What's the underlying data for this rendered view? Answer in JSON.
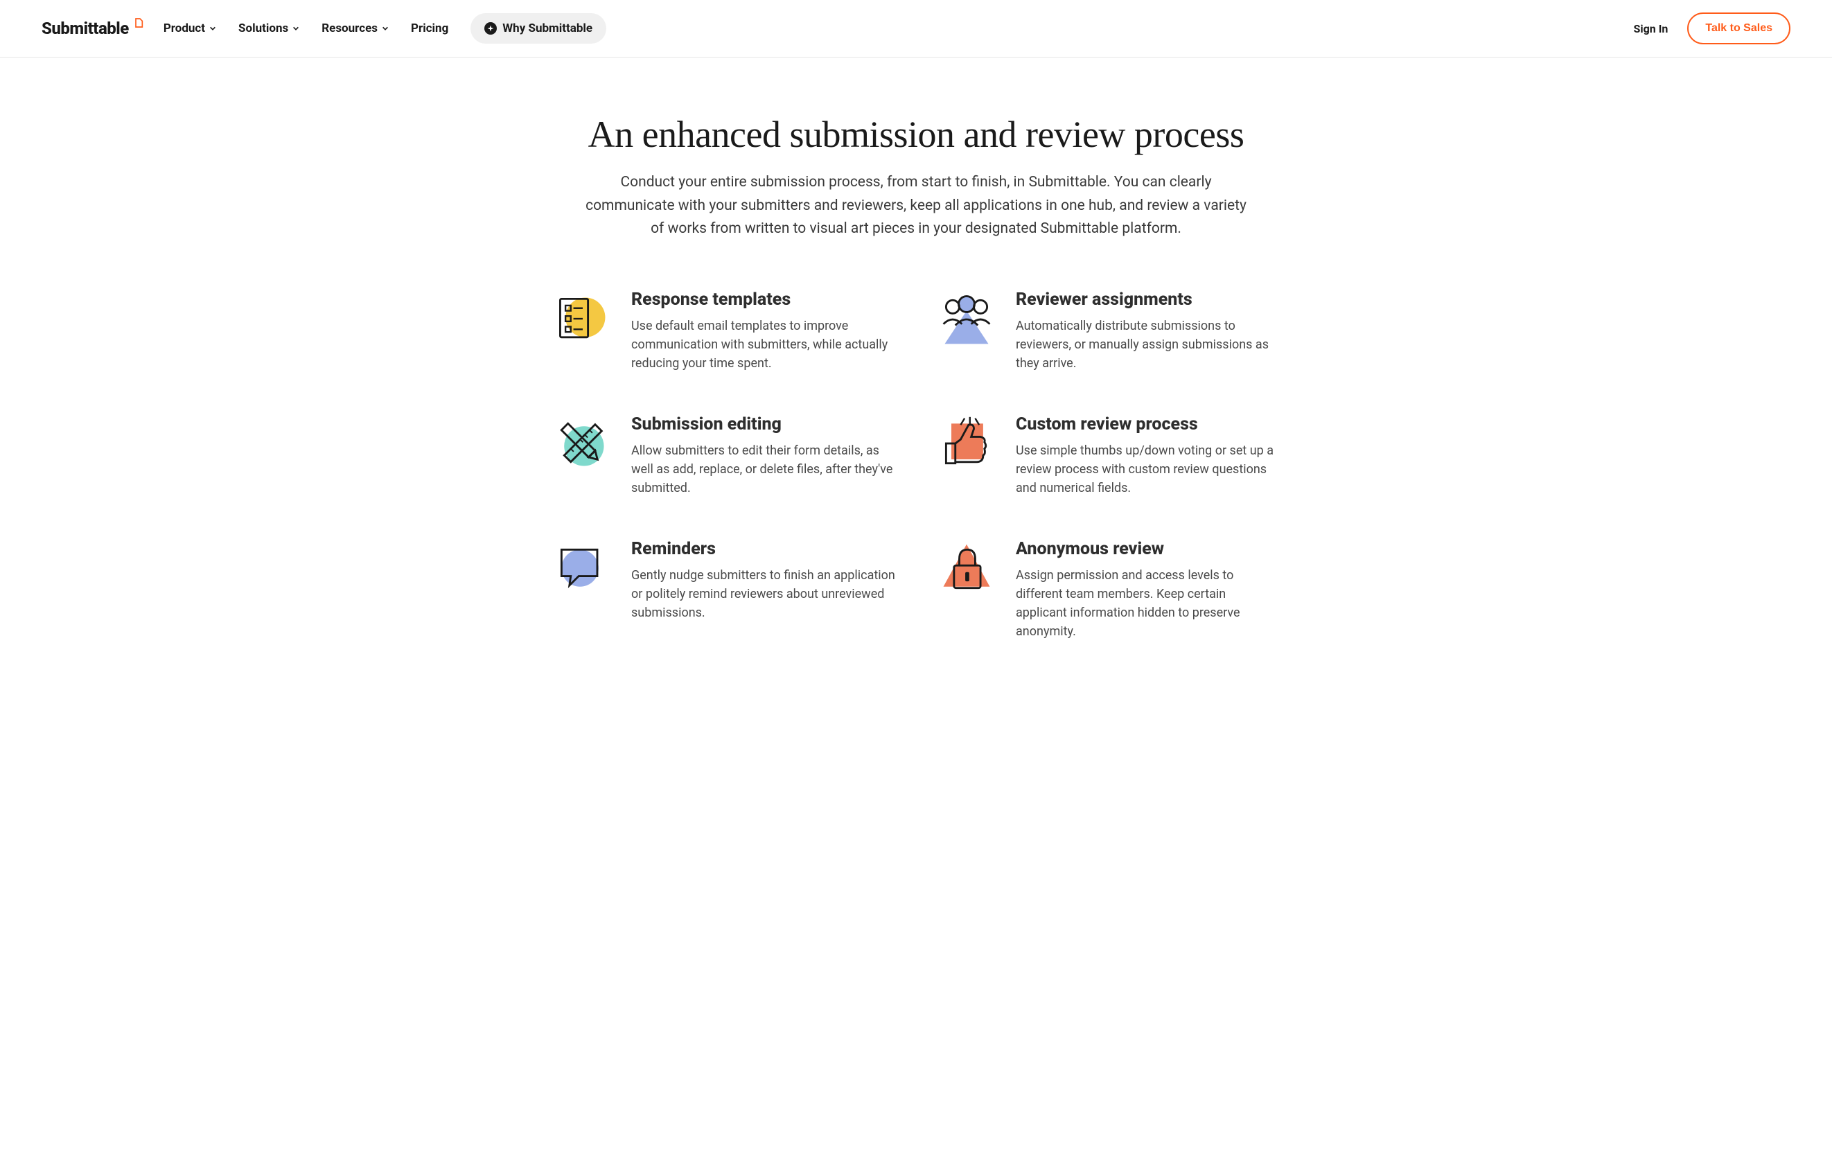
{
  "brand": {
    "name": "Submittable"
  },
  "nav": {
    "items": [
      {
        "label": "Product",
        "hasDropdown": true
      },
      {
        "label": "Solutions",
        "hasDropdown": true
      },
      {
        "label": "Resources",
        "hasDropdown": true
      },
      {
        "label": "Pricing",
        "hasDropdown": false
      }
    ],
    "why_label": "Why Submittable",
    "signin_label": "Sign In",
    "cta_label": "Talk to Sales"
  },
  "hero": {
    "title": "An enhanced submission and review process",
    "subtitle": "Conduct your entire submission process, from start to finish, in Submittable. You can clearly communicate with your submitters and reviewers, keep all applications in one hub, and review a variety of works from written to visual art pieces in your designated Submittable platform."
  },
  "features": [
    {
      "title": "Response templates",
      "desc": "Use default email templates to improve communication with submitters, while actually reducing your time spent.",
      "icon": "checklist-icon"
    },
    {
      "title": "Reviewer assignments",
      "desc": "Automatically distribute submissions to reviewers, or manually assign submissions as they arrive.",
      "icon": "people-icon"
    },
    {
      "title": "Submission editing",
      "desc": "Allow submitters to edit their form details, as well as add, replace, or delete files, after they've submitted.",
      "icon": "pencil-ruler-icon"
    },
    {
      "title": "Custom review process",
      "desc": "Use simple thumbs up/down voting or set up a review process with custom review questions and numerical fields.",
      "icon": "thumbs-up-icon"
    },
    {
      "title": "Reminders",
      "desc": "Gently nudge submitters to finish an application or politely remind reviewers about unreviewed submissions.",
      "icon": "chat-bubble-icon"
    },
    {
      "title": "Anonymous review",
      "desc": "Assign permission and access levels to different team members. Keep certain applicant information hidden to preserve anonymity.",
      "icon": "lock-icon"
    }
  ],
  "colors": {
    "accent": "#ff5c1a",
    "yellow": "#f4c842",
    "teal": "#7fd9cc",
    "periwinkle": "#9aaee8",
    "coral": "#ed7b59"
  }
}
